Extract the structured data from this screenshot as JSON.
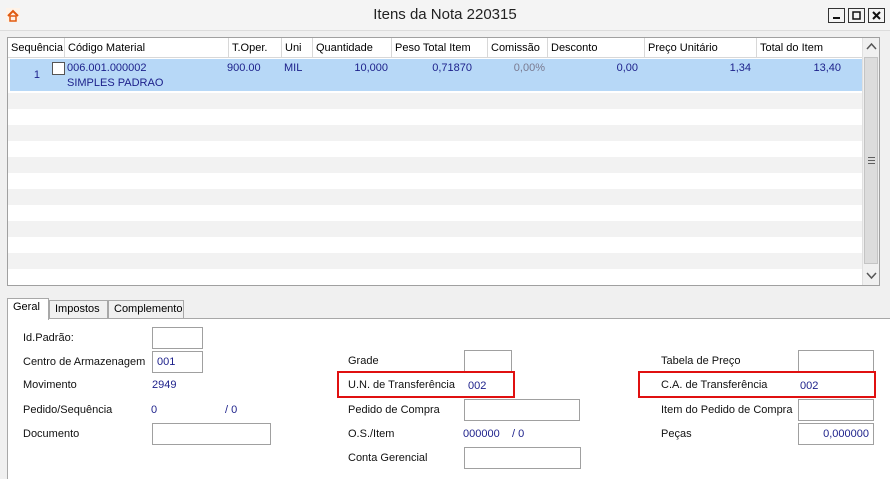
{
  "window": {
    "title": "Itens da Nota 220315"
  },
  "colors": {
    "selection": "#b7d8f7",
    "value_text": "#1b1f8a",
    "highlight": "#e01010"
  },
  "grid": {
    "columns": [
      "Sequência",
      "Código Material",
      "T.Oper.",
      "Uni",
      "Quantidade",
      "Peso Total Item",
      "Comissão",
      "Desconto",
      "Preço Unitário",
      "Total do Item"
    ],
    "rows": [
      {
        "sequencia": "1",
        "codigo": "006.001.000002",
        "descricao": "SIMPLES PADRAO",
        "t_oper": "900.00",
        "uni": "MIL",
        "quantidade": "10,000",
        "peso": "0,71870",
        "comissao": "0,00%",
        "desconto": "0,00",
        "preco": "1,34",
        "total": "13,40"
      }
    ]
  },
  "tabs": [
    "Geral",
    "Impostos",
    "Complemento"
  ],
  "form": {
    "id_padrao": {
      "label": "Id.Padrão:",
      "value": ""
    },
    "centro_armazenagem": {
      "label": "Centro de Armazenagem",
      "value": "001"
    },
    "movimento": {
      "label": "Movimento",
      "value": "2949"
    },
    "pedido_sequencia": {
      "label": "Pedido/Sequência",
      "pedido": "0",
      "sequencia": "/ 0"
    },
    "documento": {
      "label": "Documento",
      "value": ""
    },
    "grade": {
      "label": "Grade",
      "value": ""
    },
    "un_transferencia": {
      "label": "U.N. de Transferência",
      "value": "002"
    },
    "pedido_compra": {
      "label": "Pedido de Compra",
      "value": ""
    },
    "os_item": {
      "label": "O.S./Item",
      "os": "000000",
      "item": "/ 0"
    },
    "conta_gerencial": {
      "label": "Conta Gerencial",
      "value": ""
    },
    "tabela_preco": {
      "label": "Tabela de Preço",
      "value": ""
    },
    "ca_transferencia": {
      "label": "C.A. de Transferência",
      "value": "002"
    },
    "item_pedido_compra": {
      "label": "Item do Pedido de Compra",
      "value": ""
    },
    "pecas": {
      "label": "Peças",
      "value": "0,000000"
    }
  }
}
